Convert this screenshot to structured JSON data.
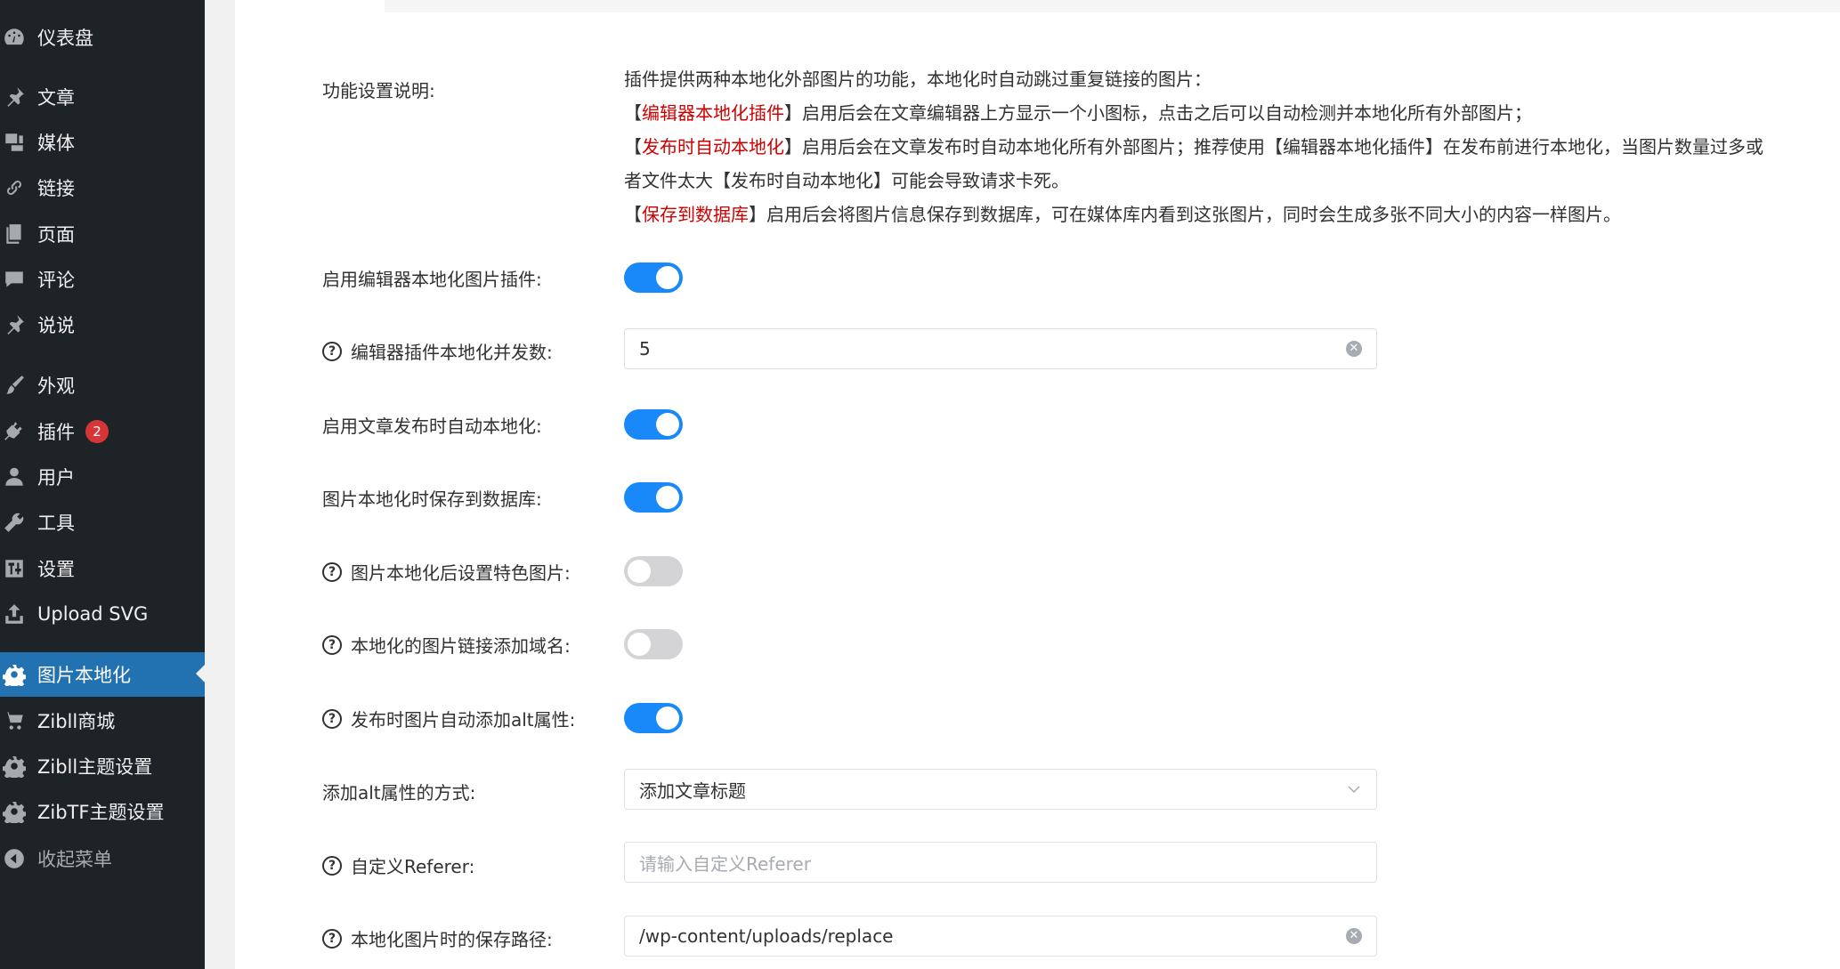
{
  "sidebar": {
    "items": [
      {
        "label": "仪表盘",
        "icon": "dashboard-icon"
      },
      {
        "label": "文章",
        "icon": "pin-icon"
      },
      {
        "label": "媒体",
        "icon": "media-icon"
      },
      {
        "label": "链接",
        "icon": "link-icon"
      },
      {
        "label": "页面",
        "icon": "page-icon"
      },
      {
        "label": "评论",
        "icon": "comment-icon"
      },
      {
        "label": "说说",
        "icon": "pin-icon"
      },
      {
        "label": "外观",
        "icon": "brush-icon"
      },
      {
        "label": "插件",
        "icon": "plugin-icon",
        "badge": "2"
      },
      {
        "label": "用户",
        "icon": "user-icon"
      },
      {
        "label": "工具",
        "icon": "wrench-icon"
      },
      {
        "label": "设置",
        "icon": "settings-icon"
      },
      {
        "label": "Upload SVG",
        "icon": "upload-icon"
      },
      {
        "label": "图片本地化",
        "icon": "gear-icon",
        "active": true
      },
      {
        "label": "Zibll商城",
        "icon": "cart-icon"
      },
      {
        "label": "Zibll主题设置",
        "icon": "gear-icon"
      },
      {
        "label": "ZibTF主题设置",
        "icon": "gear-icon"
      },
      {
        "label": "收起菜单",
        "icon": "collapse-icon"
      }
    ]
  },
  "settings": {
    "description": {
      "label": "功能设置说明:",
      "line1": "插件提供两种本地化外部图片的功能，本地化时自动跳过重复链接的图片：",
      "line2_open": "【",
      "line2_red": "编辑器本地化插件",
      "line2_rest": "】启用后会在文章编辑器上方显示一个小图标，点击之后可以自动检测并本地化所有外部图片；",
      "line3_open": "【",
      "line3_red": "发布时自动本地化",
      "line3_rest": "】启用后会在文章发布时自动本地化所有外部图片；推荐使用【编辑器本地化插件】在发布前进行本地化，当图片数量过多或者文件太大【发布时自动本地化】可能会导致请求卡死。",
      "line4_open": "【",
      "line4_red": "保存到数据库",
      "line4_rest": "】启用后会将图片信息保存到数据库，可在媒体库内看到这张图片，同时会生成多张不同大小的内容一样图片。"
    },
    "editor_plugin": {
      "label": "启用编辑器本地化图片插件:",
      "on": true
    },
    "concurrency": {
      "label": "编辑器插件本地化并发数:",
      "value": "5"
    },
    "auto_publish": {
      "label": "启用文章发布时自动本地化:",
      "on": true
    },
    "save_db": {
      "label": "图片本地化时保存到数据库:",
      "on": true
    },
    "featured": {
      "label": "图片本地化后设置特色图片:",
      "on": false
    },
    "domain": {
      "label": "本地化的图片链接添加域名:",
      "on": false
    },
    "alt_auto": {
      "label": "发布时图片自动添加alt属性:",
      "on": true
    },
    "alt_mode": {
      "label": "添加alt属性的方式:",
      "value": "添加文章标题"
    },
    "referer": {
      "label": "自定义Referer:",
      "placeholder": "请输入自定义Referer"
    },
    "save_path": {
      "label": "本地化图片时的保存路径:",
      "value": "/wp-content/uploads/replace"
    }
  },
  "colors": {
    "accent": "#1989fa",
    "sidebar_bg": "#1d2327",
    "active_bg": "#2271b1",
    "highlight": "#d00000"
  }
}
